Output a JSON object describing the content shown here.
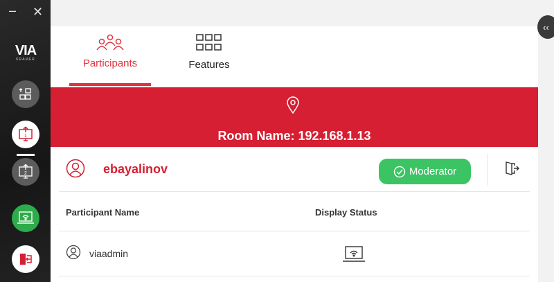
{
  "window": {
    "minimize_label": "–",
    "close_label": "✕"
  },
  "sidebar": {
    "logo_text": "VIA",
    "logo_sub": "KRAMER",
    "buttons": [
      {
        "name": "layout",
        "icon": "layout-icon"
      },
      {
        "name": "share-screen-1",
        "icon": "share-screen-1-icon"
      },
      {
        "name": "share-screen-2",
        "icon": "share-screen-2-icon"
      },
      {
        "name": "wireless-display",
        "icon": "wireless-display-icon"
      },
      {
        "name": "exit",
        "icon": "exit-door-icon"
      }
    ]
  },
  "tabs": [
    {
      "label": "Participants",
      "active": true,
      "icon": "participants-icon"
    },
    {
      "label": "Features",
      "active": false,
      "icon": "features-grid-icon"
    }
  ],
  "banner": {
    "room_name": "Room Name: 192.168.1.13",
    "icon": "location-pin-icon"
  },
  "user": {
    "name": "ebayalinov",
    "moderator_label": "Moderator",
    "icon": "user-icon"
  },
  "table": {
    "headers": {
      "name": "Participant Name",
      "status": "Display Status"
    },
    "rows": [
      {
        "name": "viaadmin",
        "display_icon": "wireless-display-icon"
      }
    ]
  },
  "colors": {
    "accent": "#d61f33",
    "green": "#3cc464",
    "sidebar": "#1f1f1f"
  },
  "collapse_label": "‹‹"
}
